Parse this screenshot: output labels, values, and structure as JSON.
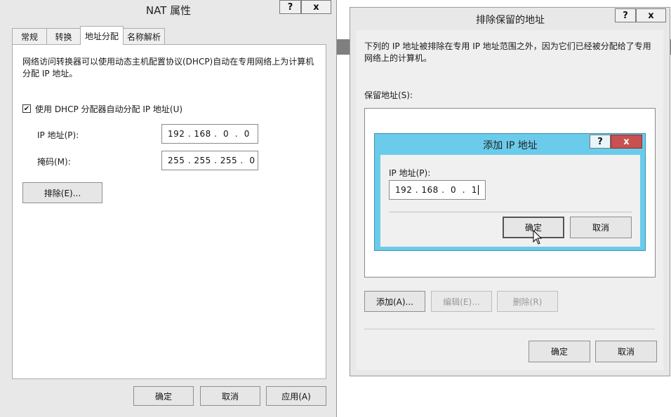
{
  "nat": {
    "title": "NAT 属性",
    "tabs": [
      {
        "label": "常规"
      },
      {
        "label": "转换"
      },
      {
        "label": "地址分配"
      },
      {
        "label": "名称解析"
      }
    ],
    "description": "网络访问转换器可以使用动态主机配置协议(DHCP)自动在专用网络上为计算机分配 IP 地址。",
    "dhcp_checkbox_label": "使用 DHCP 分配器自动分配 IP 地址(U)",
    "dhcp_checked": true,
    "ip_label": "IP 地址(P):",
    "ip_value": "192 . 168 .  0  .  0",
    "mask_label": "掩码(M):",
    "mask_value": "255 . 255 . 255 .  0",
    "exclude_button": "排除(E)...",
    "ok": "确定",
    "cancel": "取消",
    "apply": "应用(A)"
  },
  "exclude": {
    "title": "排除保留的地址",
    "description": "下列的 IP 地址被排除在专用 IP 地址范围之外，因为它们已经被分配给了专用网络上的计算机。",
    "reserved_label": "保留地址(S):",
    "add_button": "添加(A)...",
    "edit_button": "编辑(E)...",
    "delete_button": "删除(R)",
    "ok": "确定",
    "cancel": "取消"
  },
  "add_ip": {
    "title": "添加 IP 地址",
    "ip_label": "IP 地址(P):",
    "ip_value": "192 . 168 .  0  .  1",
    "ok": "确定",
    "cancel": "取消"
  },
  "titlebar_buttons": {
    "help": "?",
    "close": "x"
  },
  "colors": {
    "accent_frame": "#6bcbeb",
    "close_red": "#c75050"
  }
}
